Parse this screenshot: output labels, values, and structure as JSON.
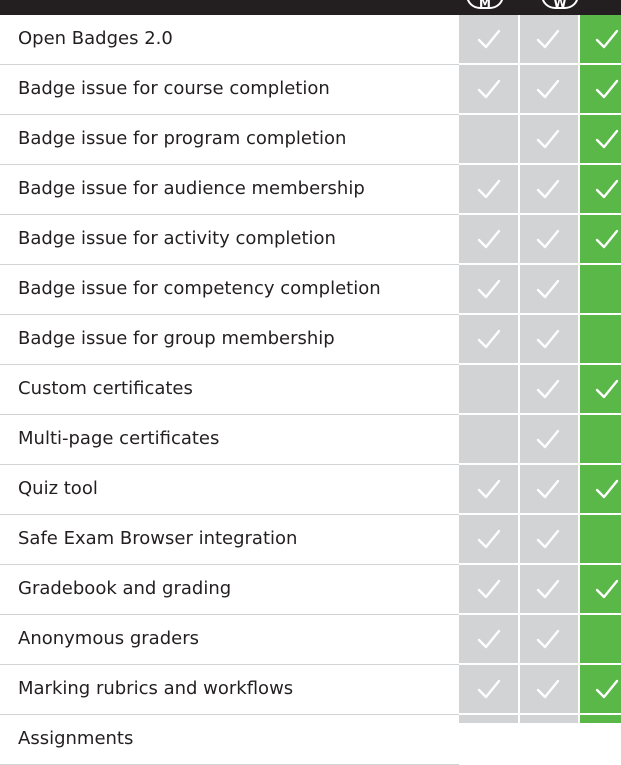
{
  "header": {
    "col_m_label": "M",
    "col_w_label": "W"
  },
  "colors": {
    "header_bg": "#231f20",
    "grey_column": "#d1d3d4",
    "green_column": "#59b847",
    "check_on_grey": "#ffffff",
    "check_on_green": "#ffffff",
    "text": "#231f20"
  },
  "icons": {
    "check": "check-icon"
  },
  "features": [
    {
      "label": "Open Badges 2.0",
      "checks": [
        true,
        true,
        true
      ]
    },
    {
      "label": "Badge issue for course completion",
      "checks": [
        true,
        true,
        true
      ]
    },
    {
      "label": "Badge issue for program completion",
      "checks": [
        false,
        true,
        true
      ]
    },
    {
      "label": "Badge issue for audience membership",
      "checks": [
        true,
        true,
        true
      ]
    },
    {
      "label": "Badge issue for activity completion",
      "checks": [
        true,
        true,
        true
      ]
    },
    {
      "label": "Badge issue for competency completion",
      "checks": [
        true,
        true,
        false
      ]
    },
    {
      "label": "Badge issue for group membership",
      "checks": [
        true,
        true,
        false
      ]
    },
    {
      "label": "Custom certificates",
      "checks": [
        false,
        true,
        true
      ]
    },
    {
      "label": "Multi-page certificates",
      "checks": [
        false,
        true,
        false
      ]
    },
    {
      "label": "Quiz tool",
      "checks": [
        true,
        true,
        true
      ]
    },
    {
      "label": "Safe Exam Browser integration",
      "checks": [
        true,
        true,
        false
      ]
    },
    {
      "label": "Gradebook and grading",
      "checks": [
        true,
        true,
        true
      ]
    },
    {
      "label": "Anonymous graders",
      "checks": [
        true,
        true,
        false
      ]
    },
    {
      "label": "Marking rubrics and workflows",
      "checks": [
        true,
        true,
        true
      ]
    },
    {
      "label": "Assignments",
      "checks": [
        true,
        true,
        true
      ]
    }
  ]
}
